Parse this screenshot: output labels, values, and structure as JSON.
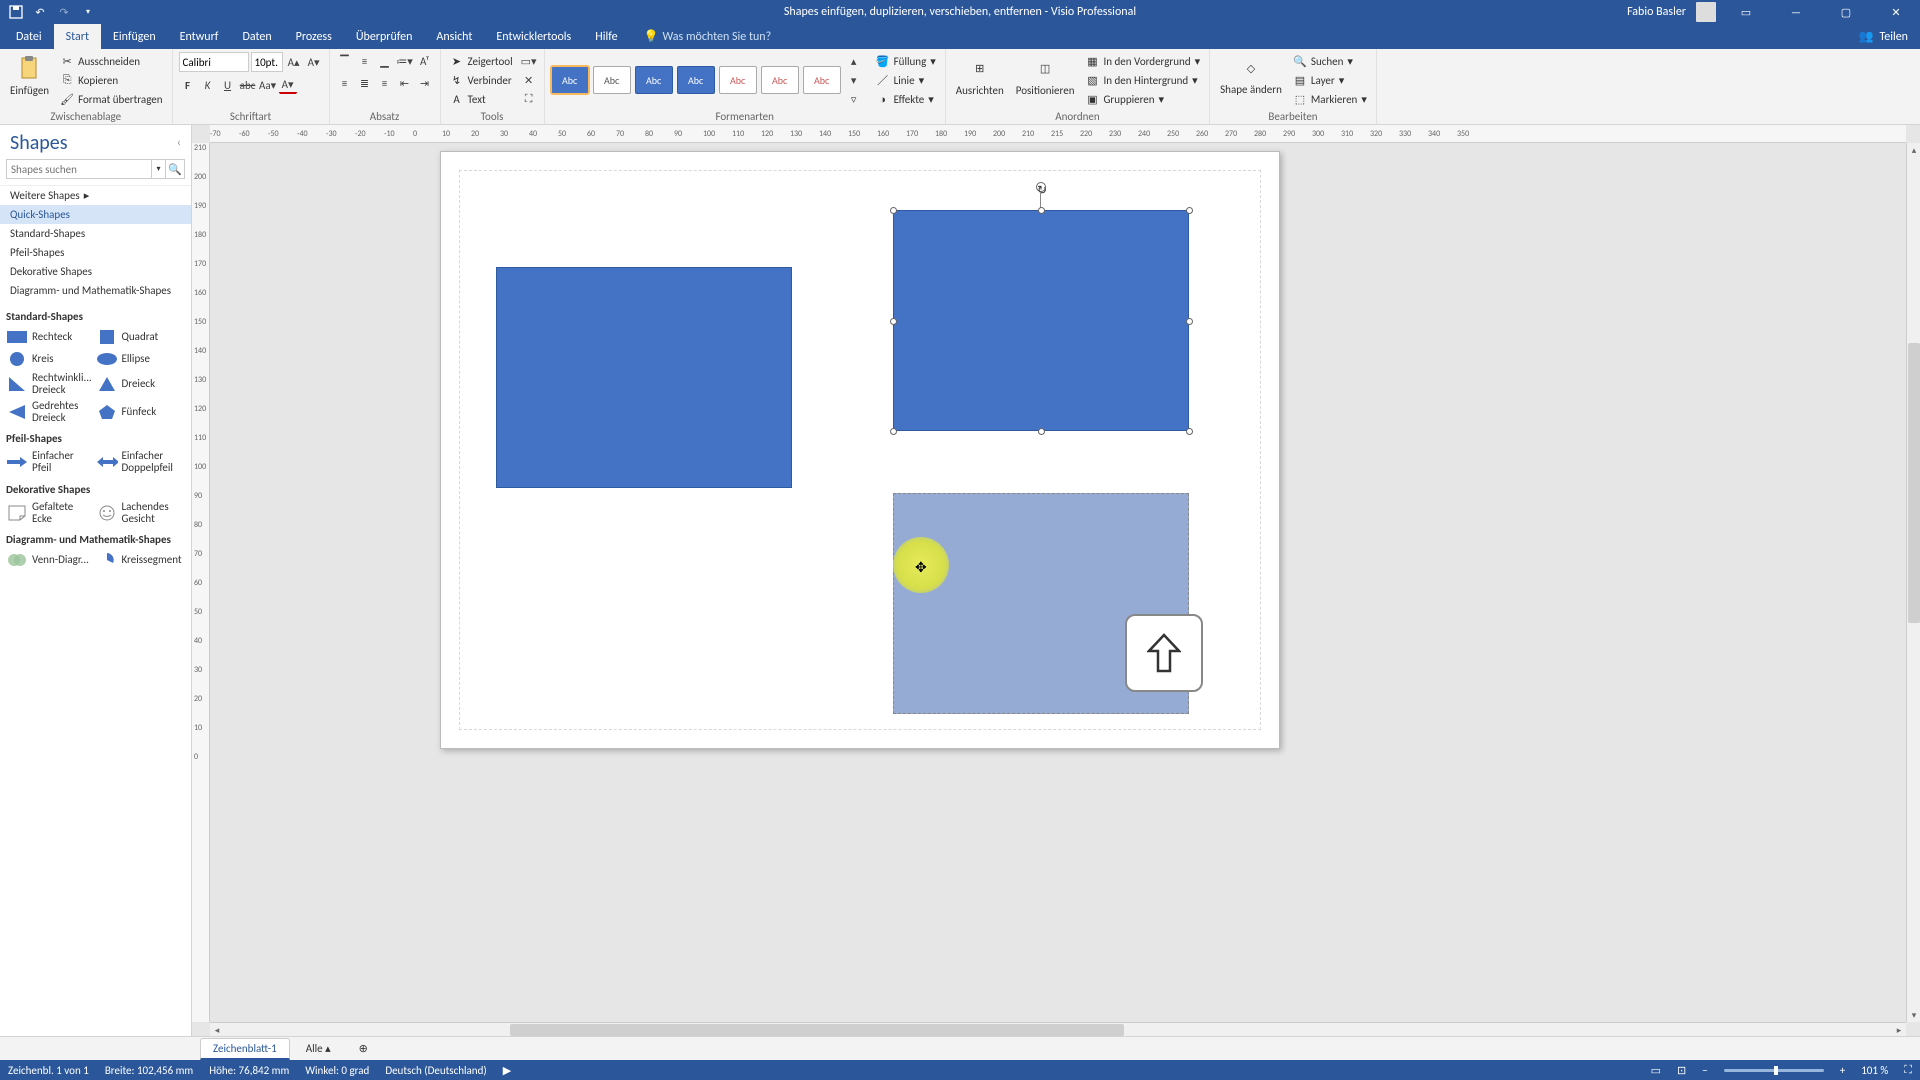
{
  "title": "Shapes einfügen, duplizieren, verschieben, entfernen  -  Visio Professional",
  "user": "Fabio Basler",
  "tabs": [
    "Datei",
    "Start",
    "Einfügen",
    "Entwurf",
    "Daten",
    "Prozess",
    "Überprüfen",
    "Ansicht",
    "Entwicklertools",
    "Hilfe"
  ],
  "active_tab": 1,
  "tell_me": "Was möchten Sie tun?",
  "share": "Teilen",
  "ribbon": {
    "clipboard": {
      "label": "Zwischenablage",
      "paste": "Einfügen",
      "cut": "Ausschneiden",
      "copy": "Kopieren",
      "format": "Format übertragen"
    },
    "font": {
      "label": "Schriftart",
      "name": "Calibri",
      "size": "10pt."
    },
    "paragraph": {
      "label": "Absatz"
    },
    "tools": {
      "label": "Tools",
      "pointer": "Zeigertool",
      "connector": "Verbinder",
      "text": "Text"
    },
    "shape_styles": {
      "label": "Formenarten",
      "fill": "Füllung",
      "line": "Linie",
      "effects": "Effekte",
      "style_text": "Abc"
    },
    "arrange": {
      "label": "Anordnen",
      "align": "Ausrichten",
      "position": "Positionieren",
      "front": "In den Vordergrund",
      "back": "In den Hintergrund",
      "group": "Gruppieren"
    },
    "editing": {
      "label": "Bearbeiten",
      "change": "Shape ändern",
      "find": "Suchen",
      "layer": "Layer",
      "select": "Markieren"
    }
  },
  "shapes_pane": {
    "title": "Shapes",
    "search_placeholder": "Shapes suchen",
    "more": "Weitere Shapes",
    "stencils": [
      "Quick-Shapes",
      "Standard-Shapes",
      "Pfeil-Shapes",
      "Dekorative Shapes",
      "Diagramm- und Mathematik-Shapes"
    ],
    "active_stencil": 0,
    "sections": {
      "standard": {
        "title": "Standard-Shapes",
        "items": [
          "Rechteck",
          "Quadrat",
          "Kreis",
          "Ellipse",
          "Rechtwinkli... Dreieck",
          "Dreieck",
          "Gedrehtes Dreieck",
          "Fünfeck"
        ]
      },
      "arrow": {
        "title": "Pfeil-Shapes",
        "items": [
          "Einfacher Pfeil",
          "Einfacher Doppelpfeil"
        ]
      },
      "deco": {
        "title": "Dekorative Shapes",
        "items": [
          "Gefaltete Ecke",
          "Lachendes Gesicht"
        ]
      },
      "math": {
        "title": "Diagramm- und Mathematik-Shapes",
        "items": [
          "Venn-Diagr...",
          "Kreissegment"
        ]
      }
    }
  },
  "hruler_ticks": [
    -70,
    -60,
    -50,
    -40,
    -30,
    -20,
    -10,
    0,
    10,
    20,
    30,
    40,
    50,
    60,
    70,
    80,
    90,
    100,
    110,
    120,
    130,
    140,
    150,
    160,
    170,
    180,
    190,
    200,
    210,
    215,
    220,
    230,
    240,
    250,
    260,
    270,
    280,
    290,
    300,
    310,
    320,
    330,
    340,
    350
  ],
  "vruler_ticks": [
    210,
    200,
    190,
    180,
    170,
    160,
    150,
    140,
    130,
    120,
    110,
    100,
    90,
    80,
    70,
    60,
    50,
    40,
    30,
    20,
    10,
    0
  ],
  "sheet": {
    "name": "Zeichenblatt-1",
    "all": "Alle"
  },
  "status": {
    "page": "Zeichenbl. 1 von 1",
    "width": "Breite: 102,456 mm",
    "height": "Höhe: 76,842 mm",
    "angle": "Winkel: 0 grad",
    "lang": "Deutsch (Deutschland)",
    "zoom": "101 %"
  }
}
